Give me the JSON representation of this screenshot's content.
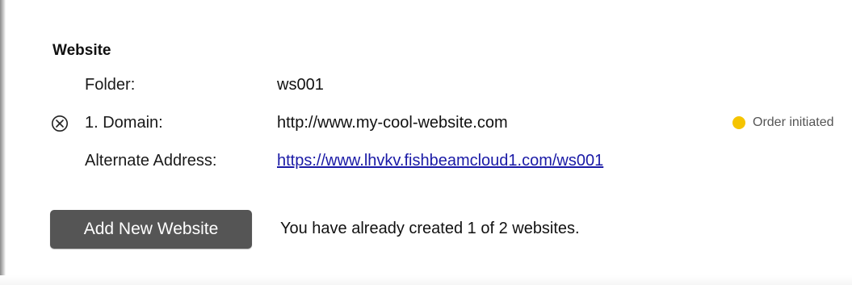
{
  "section": {
    "title": "Website"
  },
  "rows": {
    "folder": {
      "label": "Folder:",
      "value": "ws001"
    },
    "domain": {
      "label": "1. Domain:",
      "value": "http://www.my-cool-website.com",
      "remove_icon": "circled-x-icon"
    },
    "alternate": {
      "label": "Alternate Address:",
      "value": "https://www.lhvkv.fishbeamcloud1.com/ws001"
    }
  },
  "status": {
    "text": "Order initiated",
    "color": "#f5c400"
  },
  "actions": {
    "add_label": "Add New Website",
    "usage_text": "You have already created 1 of 2 websites."
  },
  "colors": {
    "button_bg": "#555555",
    "link": "#1a1aa6"
  }
}
